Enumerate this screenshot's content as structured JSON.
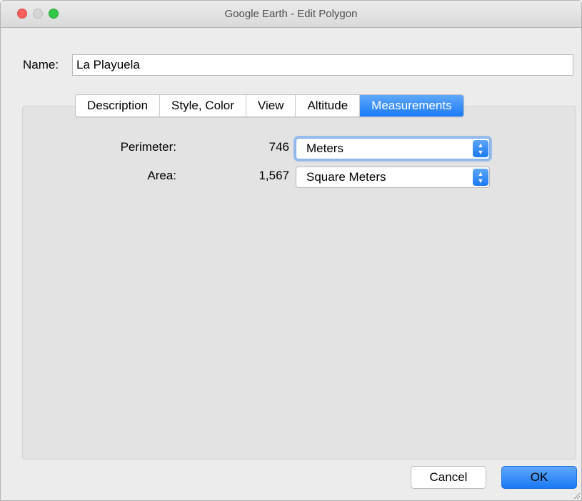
{
  "window": {
    "title": "Google Earth - Edit Polygon"
  },
  "name_field": {
    "label": "Name:",
    "value": "La Playuela"
  },
  "tabs": [
    {
      "label": "Description",
      "active": false
    },
    {
      "label": "Style, Color",
      "active": false
    },
    {
      "label": "View",
      "active": false
    },
    {
      "label": "Altitude",
      "active": false
    },
    {
      "label": "Measurements",
      "active": true
    }
  ],
  "measurements": {
    "perimeter": {
      "label": "Perimeter:",
      "value": "746",
      "unit": "Meters"
    },
    "area": {
      "label": "Area:",
      "value": "1,567",
      "unit": "Square Meters"
    }
  },
  "buttons": {
    "cancel_label": "Cancel",
    "ok_label": "OK"
  },
  "colors": {
    "accent": "#1b7bf6",
    "close": "#fc605c",
    "maximize": "#34c84a"
  }
}
